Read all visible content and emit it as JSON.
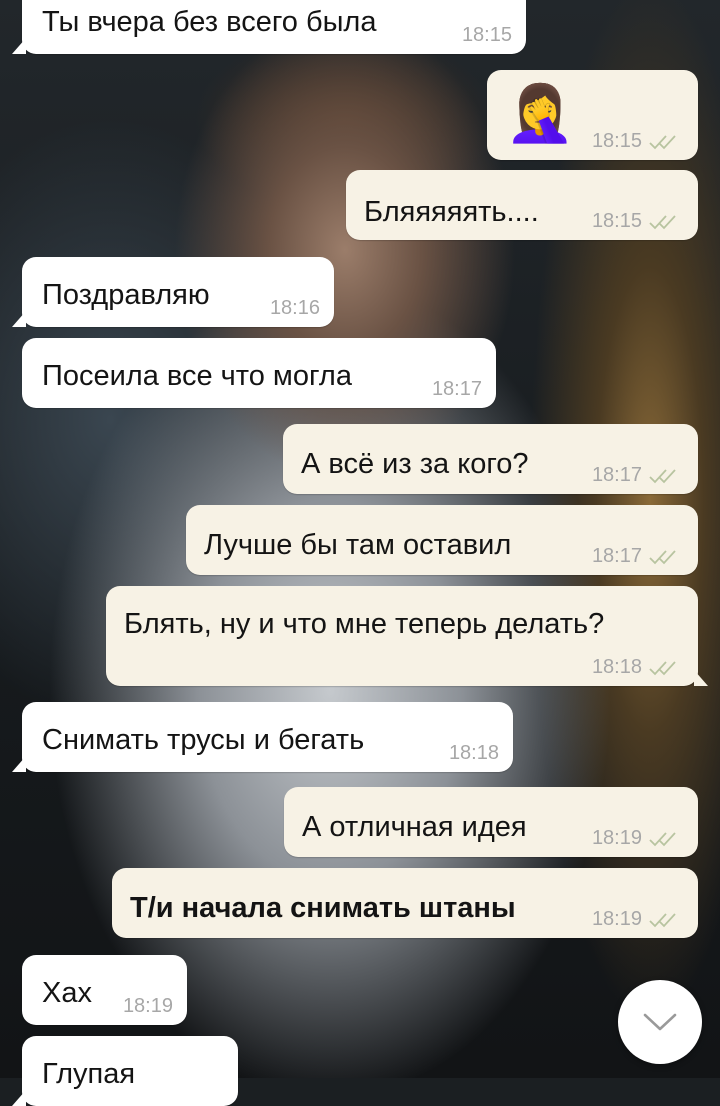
{
  "messages": [
    {
      "side": "in",
      "text": "Ты вчера без всего была",
      "time": "18:15"
    },
    {
      "side": "out",
      "emoji": "🤦‍♀️",
      "time": "18:15",
      "read": true
    },
    {
      "side": "out",
      "text": "Бляяяяять....",
      "time": "18:15",
      "read": true
    },
    {
      "side": "in",
      "text": "Поздравляю",
      "time": "18:16"
    },
    {
      "side": "in",
      "text": "Посеила все что могла",
      "time": "18:17"
    },
    {
      "side": "out",
      "text": "А всё из за кого?",
      "time": "18:17",
      "read": true
    },
    {
      "side": "out",
      "text": "Лучше бы там оставил",
      "time": "18:17",
      "read": true
    },
    {
      "side": "out",
      "text": "Блять, ну и что мне теперь делать?",
      "time": "18:18",
      "read": true
    },
    {
      "side": "in",
      "text": "Снимать трусы и бегать",
      "time": "18:18"
    },
    {
      "side": "out",
      "text": "А отличная идея",
      "time": "18:19",
      "read": true
    },
    {
      "side": "out",
      "text": "Т/и начала снимать штаны",
      "time": "18:19",
      "read": true,
      "bold": true
    },
    {
      "side": "in",
      "text": "Хах",
      "time": "18:19"
    },
    {
      "side": "in",
      "text": "Глупая"
    }
  ],
  "scroll_button": {
    "icon": "chevron-down-icon"
  },
  "colors": {
    "incoming_bubble": "#ffffff",
    "outgoing_bubble": "#f7f2e5",
    "time_text": "#a7a7a7"
  }
}
